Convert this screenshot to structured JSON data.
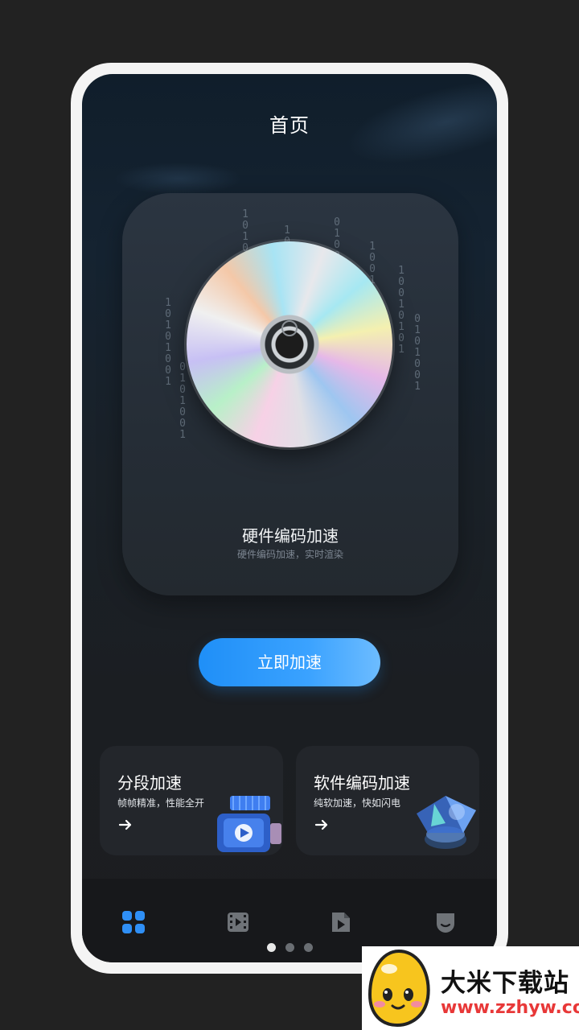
{
  "header": {
    "title": "首页"
  },
  "hero": {
    "title": "硬件编码加速",
    "subtitle": "硬件编码加速，实时渲染",
    "binary_columns": [
      "10101001",
      "0101001",
      "1010010",
      "10010101",
      "0100101",
      "1001010",
      "10010101",
      "0101001"
    ]
  },
  "primary_button": {
    "label": "立即加速",
    "color": "#1f8ff7"
  },
  "features": [
    {
      "title": "分段加速",
      "subtitle": "帧帧精准，性能全开",
      "icon": "arrow-right-icon"
    },
    {
      "title": "软件编码加速",
      "subtitle": "纯软加速，快如闪电",
      "icon": "arrow-right-icon"
    }
  ],
  "bottom_nav": {
    "items": [
      {
        "icon": "grid-icon",
        "active": true
      },
      {
        "icon": "video-film-icon",
        "active": false
      },
      {
        "icon": "video-file-icon",
        "active": false
      },
      {
        "icon": "profile-icon",
        "active": false
      }
    ],
    "active_color": "#2f8ff6",
    "inactive_color": "#6f7378"
  },
  "pager": {
    "count": 3,
    "active_index": 0
  },
  "watermark": {
    "name": "大米下载站",
    "url": "www.zzhyw.com"
  }
}
